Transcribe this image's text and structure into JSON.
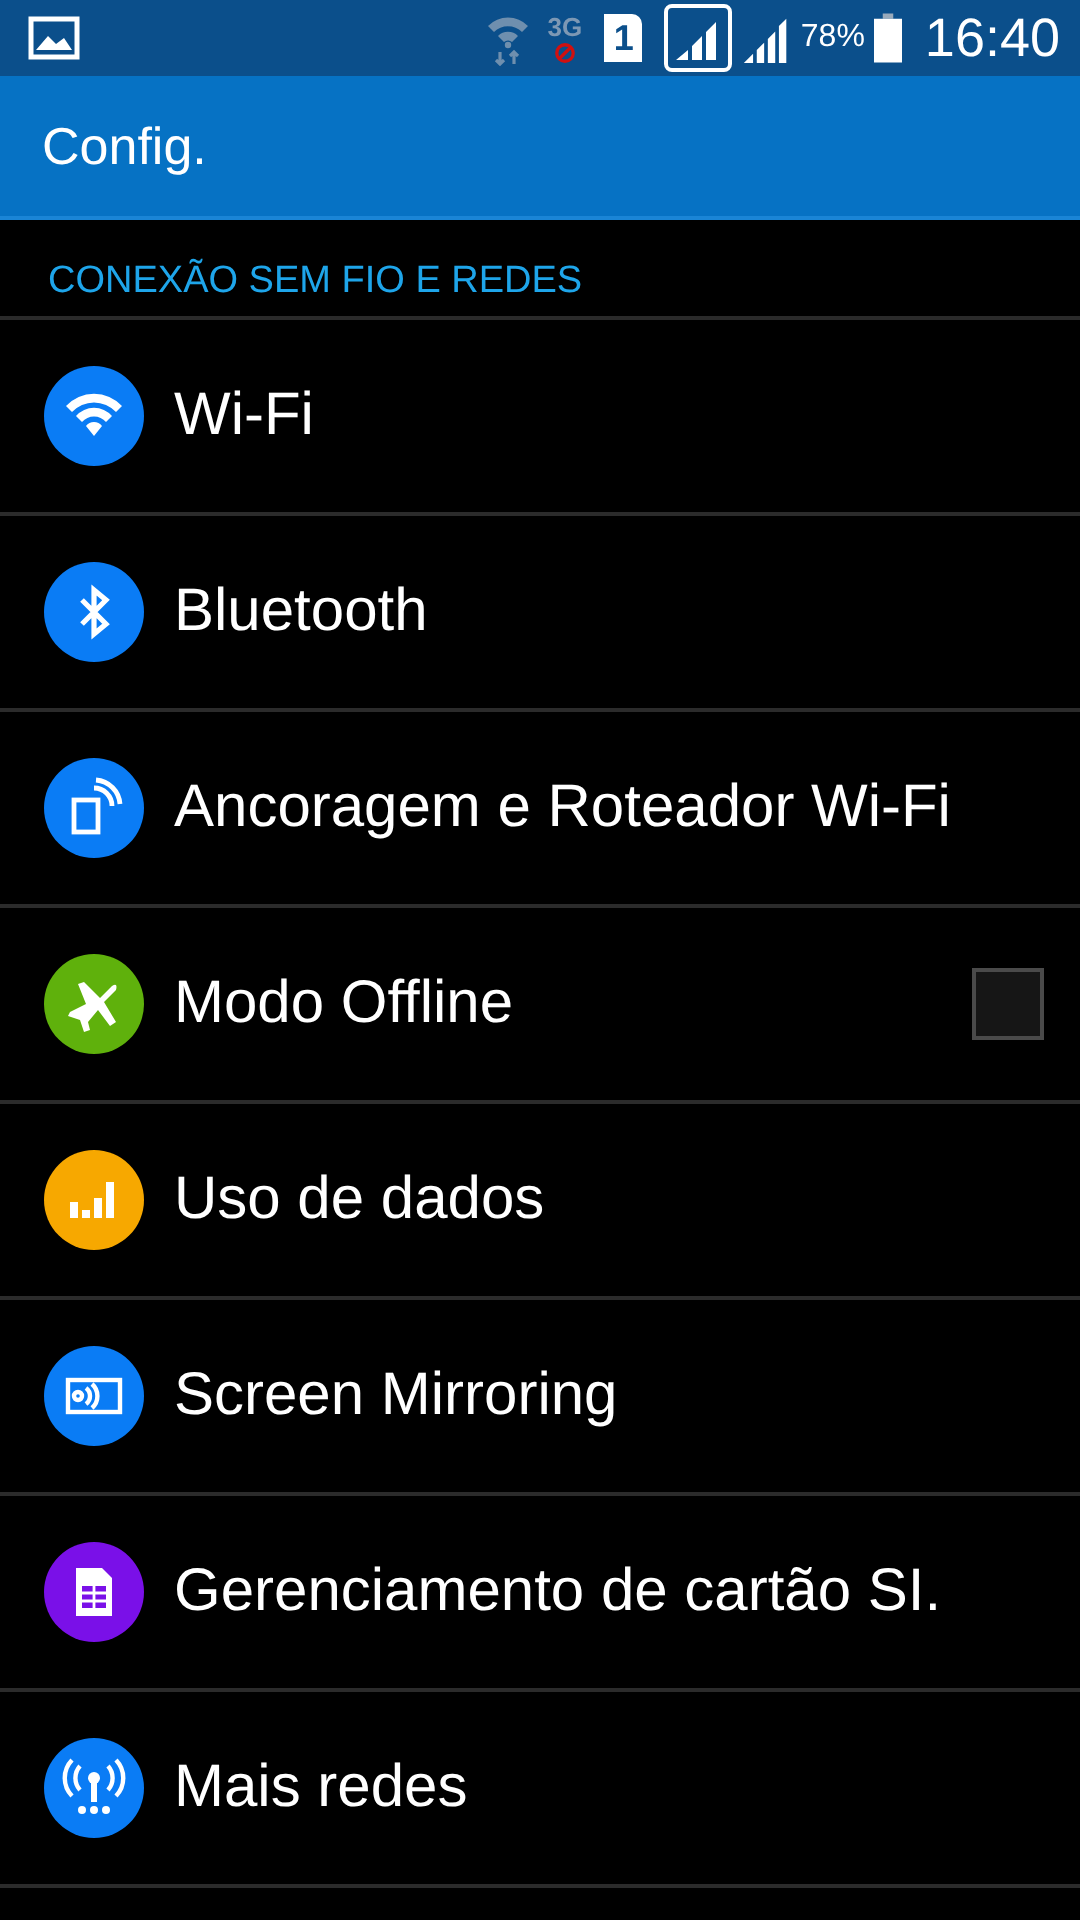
{
  "status_bar": {
    "network": "3G",
    "sim": "1",
    "battery": "78%",
    "time": "16:40"
  },
  "app_bar": {
    "title": "Config."
  },
  "section": {
    "title": "CONEXÃO SEM FIO E REDES"
  },
  "items": [
    {
      "label": "Wi-Fi",
      "color": "#0a7cf5",
      "kind": "plain"
    },
    {
      "label": "Bluetooth",
      "color": "#0a7cf5",
      "kind": "plain"
    },
    {
      "label": "Ancoragem e Roteador Wi-Fi",
      "color": "#0a7cf5",
      "kind": "plain"
    },
    {
      "label": "Modo Offline",
      "color": "#5fb10c",
      "kind": "checkbox",
      "checked": false
    },
    {
      "label": "Uso de dados",
      "color": "#f7a800",
      "kind": "plain"
    },
    {
      "label": "Screen Mirroring",
      "color": "#0a7cf5",
      "kind": "plain"
    },
    {
      "label": "Gerenciamento de cartão SI.",
      "color": "#7a10e8",
      "kind": "plain"
    },
    {
      "label": "Mais redes",
      "color": "#0a7cf5",
      "kind": "plain"
    }
  ]
}
